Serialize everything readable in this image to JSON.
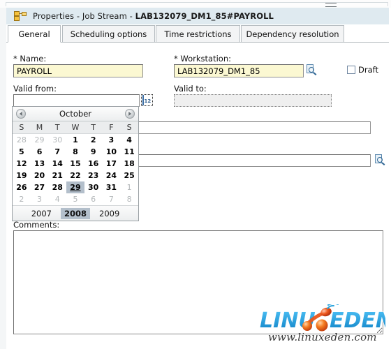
{
  "window": {
    "icon": "job-stream-icon",
    "title_prefix": "Properties - Job Stream - ",
    "title_object": "LAB132079_DM1_85#PAYROLL"
  },
  "tabs": [
    {
      "label": "General",
      "active": true
    },
    {
      "label": "Scheduling options",
      "active": false
    },
    {
      "label": "Time restrictions",
      "active": false
    },
    {
      "label": "Dependency resolution",
      "active": false
    }
  ],
  "form": {
    "name": {
      "label": "* Name:",
      "value": "PAYROLL"
    },
    "workstation": {
      "label": "* Workstation:",
      "value": "LAB132079_DM1_85",
      "lookup_icon": "lookup-magnifier-icon"
    },
    "draft": {
      "label": "Draft",
      "checked": false
    },
    "valid_from": {
      "label": "Valid from:",
      "value": "",
      "picker_icon": "calendar-icon"
    },
    "valid_to": {
      "label": "Valid to:",
      "value": "",
      "disabled": true
    },
    "hidden_field_1": {
      "value": ""
    },
    "hidden_field_2": {
      "value": "",
      "lookup_icon": "lookup-magnifier-icon"
    },
    "comments": {
      "label": "Comments:",
      "value": ""
    }
  },
  "calendar": {
    "month": "October",
    "prev_icon": "chevron-left-icon",
    "next_icon": "chevron-right-icon",
    "weekday_headers": [
      "S",
      "M",
      "T",
      "W",
      "T",
      "F",
      "S"
    ],
    "weeks": [
      [
        {
          "d": "28",
          "o": true
        },
        {
          "d": "29",
          "o": true
        },
        {
          "d": "30",
          "o": true
        },
        {
          "d": "1"
        },
        {
          "d": "2"
        },
        {
          "d": "3"
        },
        {
          "d": "4"
        }
      ],
      [
        {
          "d": "5"
        },
        {
          "d": "6"
        },
        {
          "d": "7"
        },
        {
          "d": "8"
        },
        {
          "d": "9"
        },
        {
          "d": "10"
        },
        {
          "d": "11"
        }
      ],
      [
        {
          "d": "12"
        },
        {
          "d": "13"
        },
        {
          "d": "14"
        },
        {
          "d": "15"
        },
        {
          "d": "16"
        },
        {
          "d": "17"
        },
        {
          "d": "18"
        }
      ],
      [
        {
          "d": "19"
        },
        {
          "d": "20"
        },
        {
          "d": "21"
        },
        {
          "d": "22"
        },
        {
          "d": "23"
        },
        {
          "d": "24"
        },
        {
          "d": "25"
        }
      ],
      [
        {
          "d": "26"
        },
        {
          "d": "27"
        },
        {
          "d": "28"
        },
        {
          "d": "29",
          "sel": true
        },
        {
          "d": "30"
        },
        {
          "d": "31"
        },
        {
          "d": "1",
          "o": true
        }
      ],
      [
        {
          "d": "2",
          "o": true
        },
        {
          "d": "3",
          "o": true
        },
        {
          "d": "4",
          "o": true
        },
        {
          "d": "5",
          "o": true
        },
        {
          "d": "6",
          "o": true
        },
        {
          "d": "7",
          "o": true
        },
        {
          "d": "8",
          "o": true
        }
      ]
    ],
    "years": [
      {
        "label": "2007",
        "current": false
      },
      {
        "label": "2008",
        "current": true
      },
      {
        "label": "2009",
        "current": false
      }
    ]
  },
  "watermark": {
    "text_left": "LINU",
    "text_right": "EDEN",
    "url": "www.linuxeden.com"
  },
  "colors": {
    "titlebar": "#dfeaf0",
    "required_field": "#fbf8d2",
    "selection": "#b3bfcb",
    "accent_blue": "#3b6ea5",
    "icon_yellow": "#f5c23e"
  }
}
